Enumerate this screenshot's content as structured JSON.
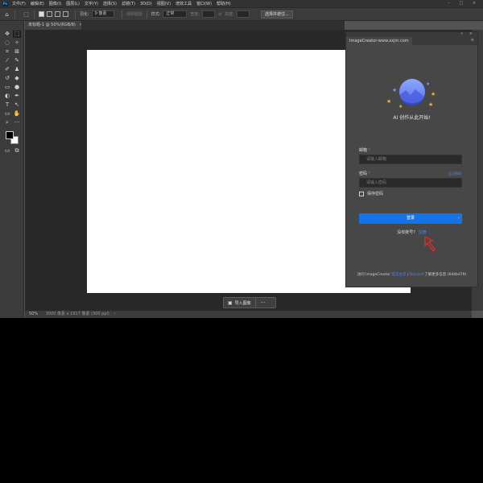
{
  "menubar": {
    "app_logo": "Ps",
    "items": [
      "文件(F)",
      "编辑(E)",
      "图像(I)",
      "图层(L)",
      "文字(Y)",
      "选择(S)",
      "滤镜(T)",
      "3D(D)",
      "视图(V)",
      "增效工具",
      "窗口(W)",
      "帮助(H)"
    ],
    "window_controls": "– □ ×"
  },
  "optionsbar": {
    "feather_label": "羽化:",
    "feather_value": "0 像素",
    "antialias_label": "消除锯齿",
    "style_label": "样式:",
    "style_value": "正常",
    "width_label": "宽度:",
    "height_label": "高度:",
    "select_subject_button": "选择并遮住..."
  },
  "document": {
    "tab_title": "未标题-1 @ 50%(RGB/8)",
    "tab_close": "×"
  },
  "importbar": {
    "import_label": "导入图像",
    "more_label": "···"
  },
  "statusbar": {
    "zoom": "50%",
    "info": "3000 像素 x 1917 像素 (300 ppi)",
    "chevron": "›"
  },
  "panel": {
    "tab_label": "ImageCreator-www.xxjm.com",
    "tagline": "AI 创作从此开始!",
    "email_label": "邮箱",
    "email_required": "*",
    "email_placeholder": "请输入邮箱",
    "password_label": "密码",
    "password_required": "*",
    "password_placeholder": "请输入密码",
    "forgot_link": "忘记密码",
    "remember_label": "保存密码",
    "login_button": "登录",
    "signup_prompt": "没有账号？",
    "signup_link": "注册",
    "footer_prefix": "访问 ImageCreator",
    "footer_link1": "官方主页",
    "footer_sep": "/",
    "footer_link2": "Discord",
    "footer_suffix": "了解更多信息 (6d4bd79)"
  },
  "colors": {
    "accent": "#1473e6",
    "link": "#4f8bff",
    "required": "#e34d4d"
  }
}
